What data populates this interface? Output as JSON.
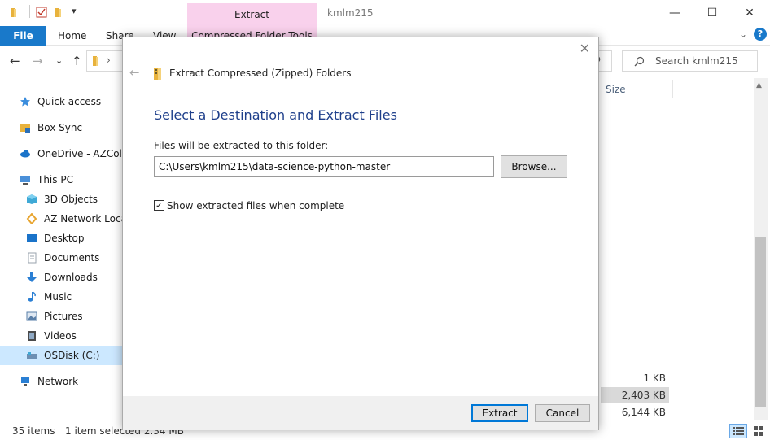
{
  "window": {
    "title": "kmlm215",
    "context_tab": "Extract",
    "controls": {
      "minimize": "—",
      "maximize": "☐",
      "close": "✕"
    }
  },
  "ribbon": {
    "tabs": [
      "File",
      "Home",
      "Share",
      "View"
    ],
    "context_subtab": "Compressed Folder Tools",
    "collapse": "⌄",
    "help": "?"
  },
  "address": {
    "back": "←",
    "forward": "→",
    "recent": "⌄",
    "up": "↑",
    "chevron": "›",
    "refresh": "↻",
    "search_placeholder": "Search kmlm215"
  },
  "nav_pane": {
    "items": [
      {
        "label": "Quick access",
        "icon": "star-icon",
        "color": "#3a8ddd"
      },
      {
        "label": "Box Sync",
        "icon": "box-folder-icon",
        "color": "#e8b23c"
      },
      {
        "label": "OneDrive - AZCollab",
        "icon": "cloud-icon",
        "color": "#1a73c9"
      },
      {
        "label": "This PC",
        "icon": "computer-icon",
        "color": "#4a90d9"
      },
      {
        "label": "3D Objects",
        "icon": "cube-icon",
        "color": "#3fa9d6"
      },
      {
        "label": "AZ Network Locations",
        "icon": "network-location-icon",
        "color": "#e8a530"
      },
      {
        "label": "Desktop",
        "icon": "desktop-icon",
        "color": "#1a73c9"
      },
      {
        "label": "Documents",
        "icon": "document-icon",
        "color": "#9aa3ad"
      },
      {
        "label": "Downloads",
        "icon": "download-icon",
        "color": "#2a7fd4"
      },
      {
        "label": "Music",
        "icon": "music-icon",
        "color": "#2a7fd4"
      },
      {
        "label": "Pictures",
        "icon": "pictures-icon",
        "color": "#5a7fa8"
      },
      {
        "label": "Videos",
        "icon": "video-icon",
        "color": "#4a4a4a"
      },
      {
        "label": "OSDisk (C:)",
        "icon": "drive-icon",
        "color": "#6d8fb3"
      },
      {
        "label": "Network",
        "icon": "network-icon",
        "color": "#2a7fd4"
      }
    ]
  },
  "file_list": {
    "column_size": "Size",
    "sizes": [
      "1 KB",
      "2,403 KB",
      "6,144 KB"
    ]
  },
  "status": {
    "items": "35 items",
    "selected": "1 item selected  2.34 MB"
  },
  "dialog": {
    "close": "✕",
    "back": "←",
    "header": "Extract Compressed (Zipped) Folders",
    "heading": "Select a Destination and Extract Files",
    "folder_label": "Files will be extracted to this folder:",
    "path_value": "C:\\Users\\kmlm215\\data-science-python-master",
    "browse_label": "Browse...",
    "checkbox_checked": true,
    "checkbox_mark": "✓",
    "checkbox_label": "Show extracted files when complete",
    "extract_label": "Extract",
    "cancel_label": "Cancel"
  }
}
